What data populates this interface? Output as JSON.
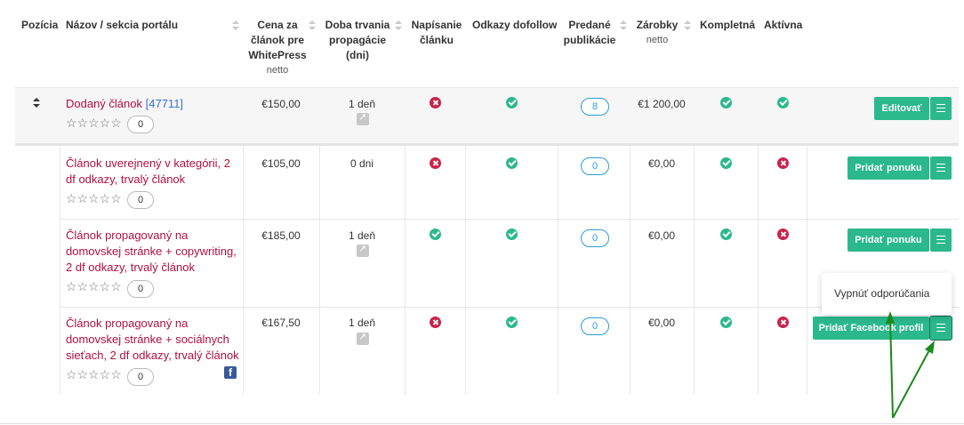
{
  "headers": {
    "position": "Pozícia",
    "name": "Názov / sekcia portálu",
    "price_l1": "Cena za",
    "price_l2": "článok pre",
    "price_l3": "WhitePress",
    "price_sub": "netto",
    "duration_l1": "Doba trvania",
    "duration_l2": "propagácie",
    "duration_l3": "(dni)",
    "writing_l1": "Napísanie",
    "writing_l2": "článku",
    "dofollow": "Odkazy dofollow",
    "sold_l1": "Predané",
    "sold_l2": "publikácie",
    "earnings": "Zárobky",
    "earnings_sub": "netto",
    "complete": "Kompletná",
    "active": "Aktívna"
  },
  "rows": [
    {
      "name": "Dodaný článok",
      "id": "[47711]",
      "stars": "☆☆☆☆☆",
      "rating_count": "0",
      "price": "€150,00",
      "duration": "1 deň",
      "writing": "no",
      "dofollow": "ok",
      "sold": "8",
      "earnings": "€1 200,00",
      "complete": "ok",
      "active": "ok",
      "action": "Editovať"
    },
    {
      "name_l1": "Článok uverejnený v kategórii, 2",
      "name_l2": "df odkazy, trvalý článok",
      "stars": "☆☆☆☆☆",
      "rating_count": "0",
      "price": "€105,00",
      "duration": "0 dni",
      "writing": "no",
      "dofollow": "ok",
      "sold": "0",
      "earnings": "€0,00",
      "complete": "ok",
      "active": "no",
      "action": "Pridať ponuku"
    },
    {
      "name_l1": "Článok propagovaný na",
      "name_l2": "domovskej stránke + copywriting,",
      "name_l3": "2 df odkazy, trvalý článok",
      "stars": "☆☆☆☆☆",
      "rating_count": "0",
      "price": "€185,00",
      "duration": "1 deň",
      "writing": "ok",
      "dofollow": "ok",
      "sold": "0",
      "earnings": "€0,00",
      "complete": "ok",
      "active": "no",
      "action": "Pridať ponuku"
    },
    {
      "name_l1": "Článok propagovaný na",
      "name_l2": "domovskej stránke + sociálnych",
      "name_l3": "sieťach, 2 df odkazy, trvalý článok",
      "stars": "☆☆☆☆☆",
      "rating_count": "0",
      "price": "€167,50",
      "duration": "1 deň",
      "writing": "no",
      "dofollow": "ok",
      "sold": "0",
      "earnings": "€0,00",
      "complete": "ok",
      "active": "no",
      "action": "Pridať Facebook profil"
    }
  ],
  "dropdown": {
    "item": "Vypnúť odporúčania"
  },
  "facebook_glyph": "f",
  "colors": {
    "accent": "#2bb88c",
    "link": "#b0103f",
    "badge": "#2e9bd6",
    "error": "#c9234a",
    "annotation": "#1a8a1a"
  }
}
